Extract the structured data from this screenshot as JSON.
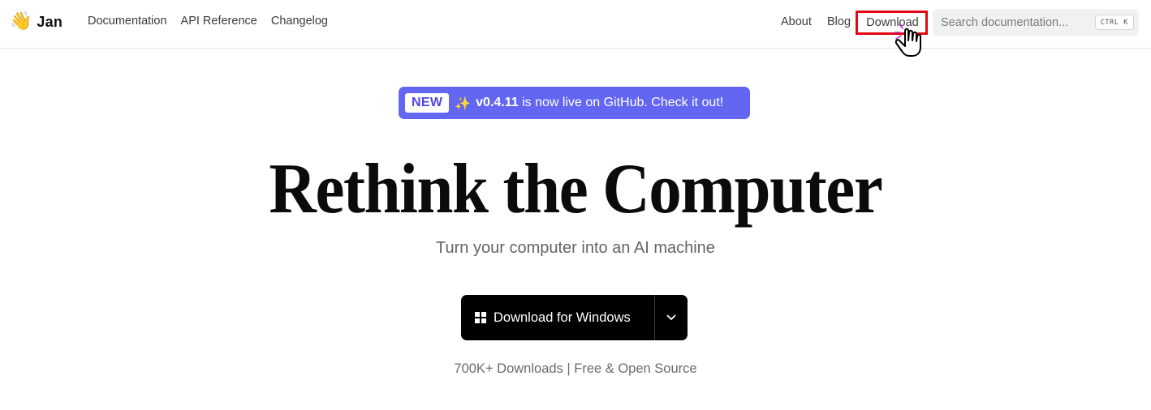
{
  "brand": {
    "emoji": "👋",
    "name": "Jan"
  },
  "nav": {
    "left": [
      "Documentation",
      "API Reference",
      "Changelog"
    ],
    "about": "About",
    "blog": "Blog",
    "download": "Download",
    "search_placeholder": "Search documentation...",
    "shortcut": "CTRL K"
  },
  "announcement": {
    "badge": "NEW",
    "sparkle": "✨",
    "version": "v0.4.11",
    "message": " is now live on GitHub. Check it out!"
  },
  "hero": {
    "title": "Rethink the Computer",
    "subtitle": "Turn your computer into an AI machine"
  },
  "download_button": {
    "label": "Download for Windows"
  },
  "stats": "700K+ Downloads | Free & Open Source",
  "colors": {
    "accent": "#6366f1",
    "highlight_box": "#e30613",
    "button_bg": "#000000"
  }
}
